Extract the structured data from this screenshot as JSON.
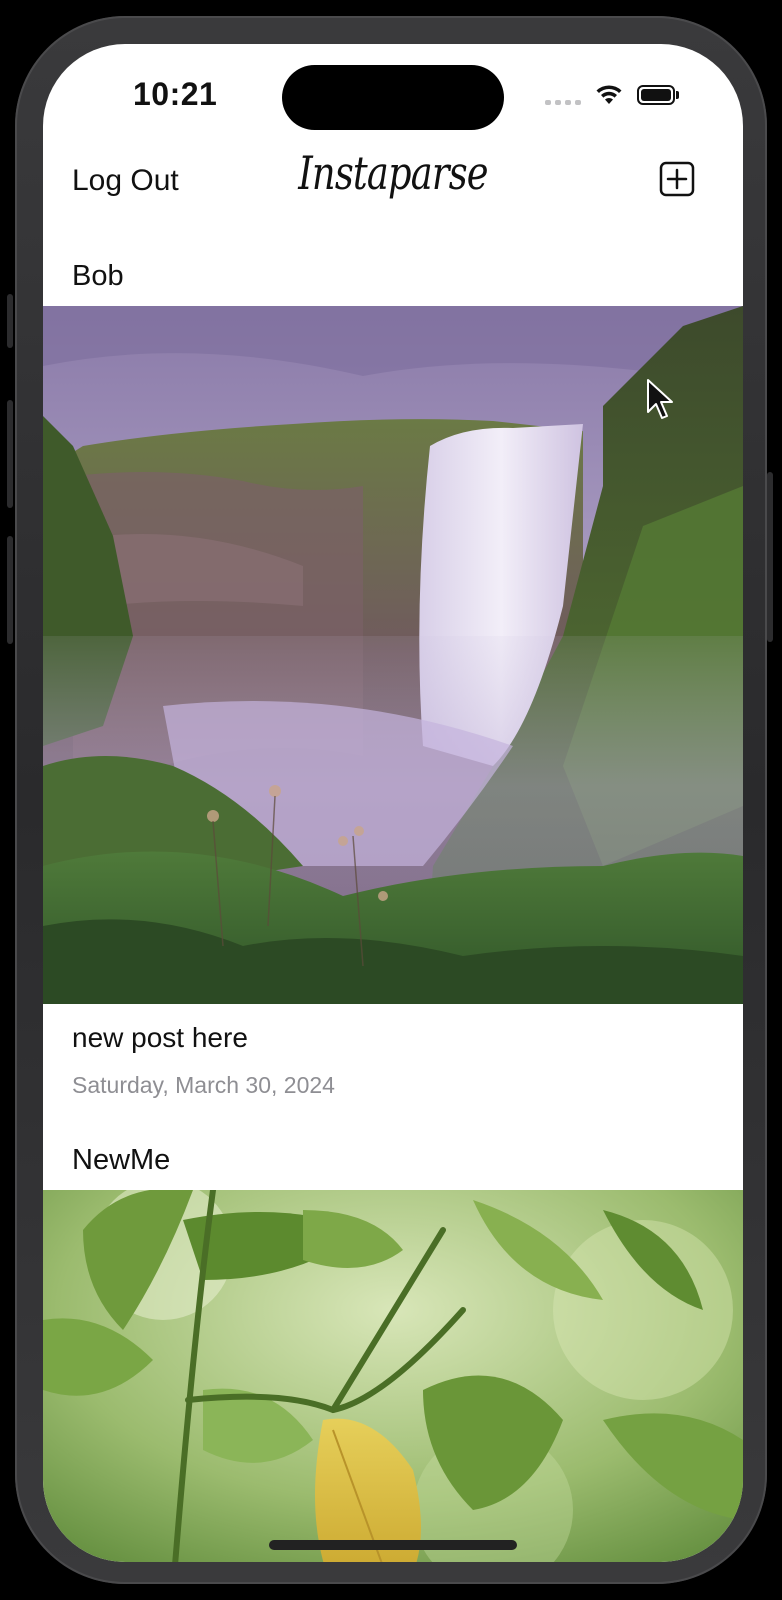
{
  "status_bar": {
    "time": "10:21",
    "icons": [
      "cellular-signal-icon",
      "wifi-icon",
      "battery-icon"
    ]
  },
  "nav": {
    "logout_label": "Log Out",
    "app_title": "Instaparse",
    "add_icon": "plus-square-icon"
  },
  "feed": {
    "posts": [
      {
        "username": "Bob",
        "image": "waterfall-photo",
        "caption": "new post here",
        "date": "Saturday, March 30, 2024"
      },
      {
        "username": "NewMe",
        "image": "leaves-photo"
      }
    ]
  },
  "colors": {
    "text": "#111111",
    "secondary_text": "#8e8e93",
    "background": "#ffffff"
  }
}
